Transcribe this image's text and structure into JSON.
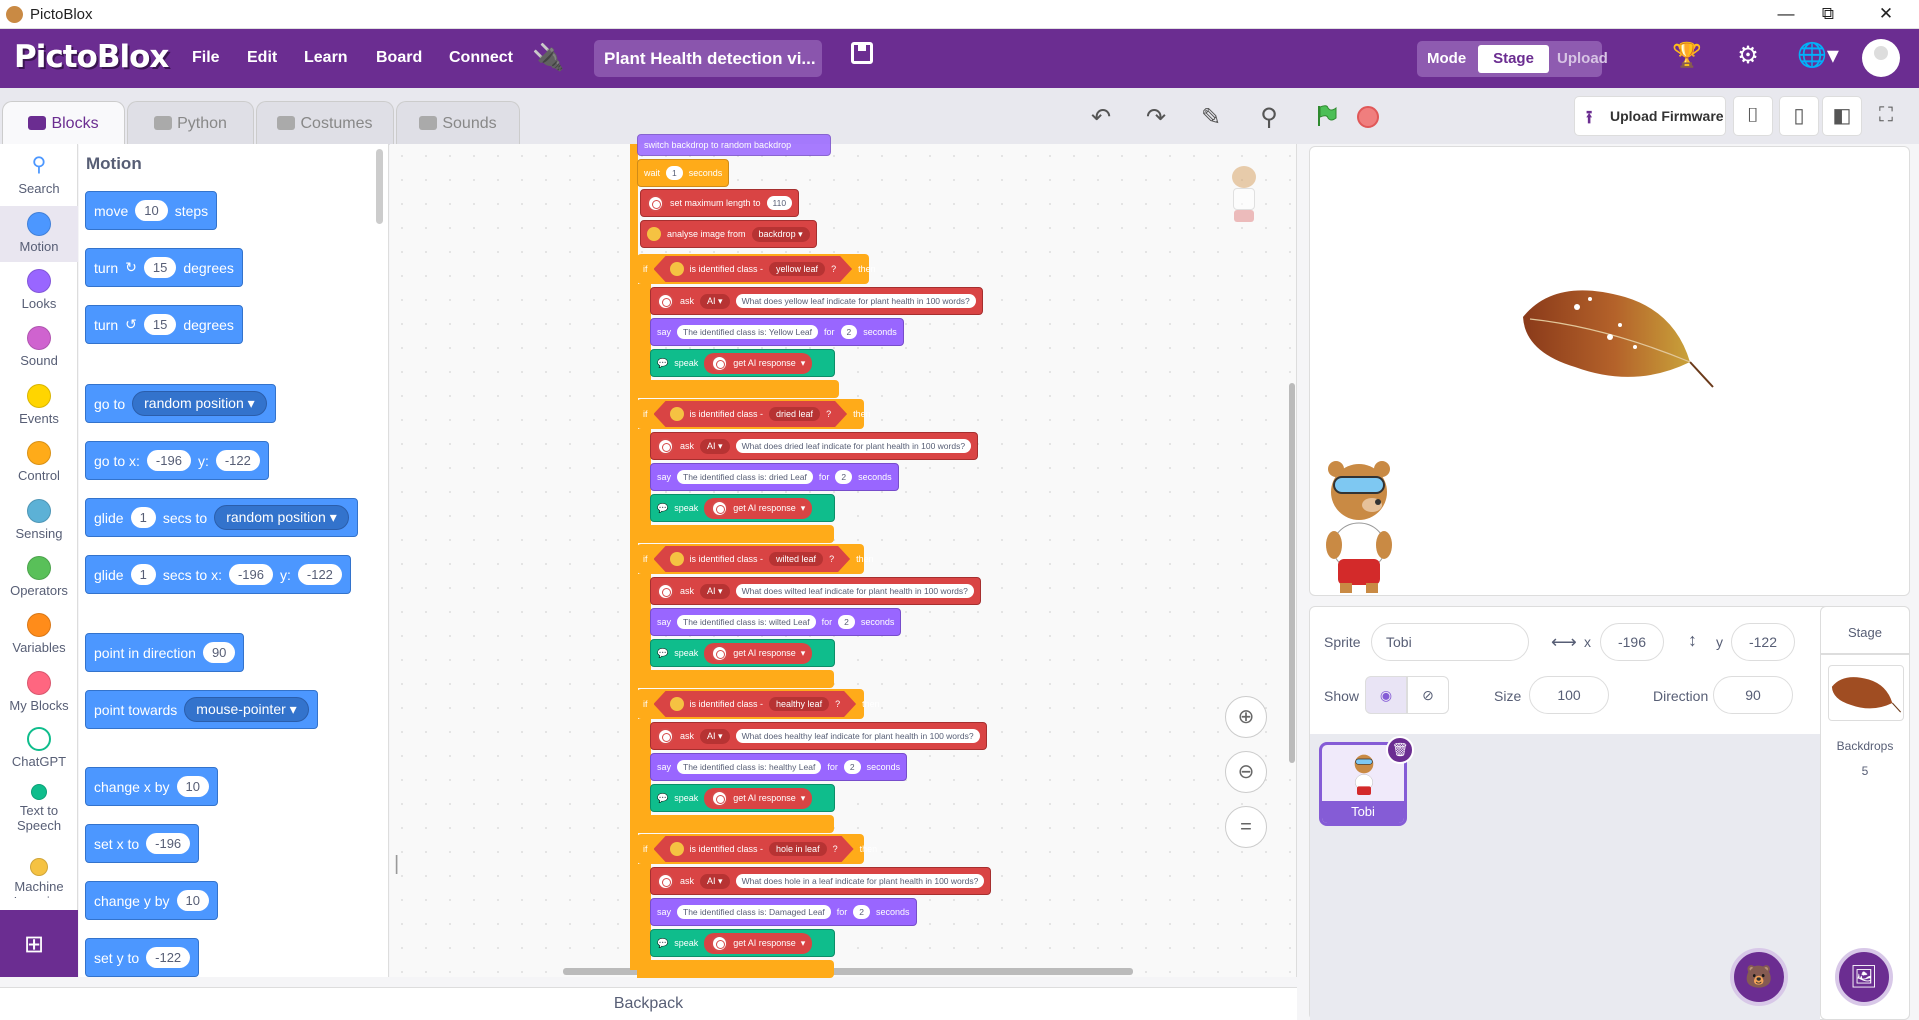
{
  "window": {
    "title": "PictoBlox",
    "minimize": "—",
    "maximize": "⧉",
    "close": "✕"
  },
  "menubar": {
    "logo": "PictoBlox",
    "items": [
      "File",
      "Edit",
      "Learn",
      "Board",
      "Connect"
    ],
    "project_title": "Plant Health detection vi...",
    "mode_label": "Mode",
    "mode_stage": "Stage",
    "mode_upload": "Upload"
  },
  "tabs": {
    "blocks": "Blocks",
    "python": "Python",
    "costumes": "Costumes",
    "sounds": "Sounds"
  },
  "toolbar": {
    "upload_firmware": "Upload Firmware"
  },
  "categories": [
    {
      "label": "Search",
      "color": "#4c97ff"
    },
    {
      "label": "Motion",
      "color": "#4c97ff"
    },
    {
      "label": "Looks",
      "color": "#9966ff"
    },
    {
      "label": "Sound",
      "color": "#cf63cf"
    },
    {
      "label": "Events",
      "color": "#ffd500"
    },
    {
      "label": "Control",
      "color": "#ffab19"
    },
    {
      "label": "Sensing",
      "color": "#5cb1d6"
    },
    {
      "label": "Operators",
      "color": "#59c059"
    },
    {
      "label": "Variables",
      "color": "#ff8c1a"
    },
    {
      "label": "My Blocks",
      "color": "#ff6680"
    },
    {
      "label": "ChatGPT",
      "color": "#0fbd8c"
    },
    {
      "label": "Text to Speech",
      "color": "#0fbd8c"
    },
    {
      "label": "Machine Learning",
      "color": "#f5c242"
    }
  ],
  "palette": {
    "title": "Motion",
    "move": {
      "a": "move",
      "v": "10",
      "b": "steps"
    },
    "turn_right": {
      "a": "turn",
      "v": "15",
      "b": "degrees"
    },
    "turn_left": {
      "a": "turn",
      "v": "15",
      "b": "degrees"
    },
    "goto": {
      "a": "go to",
      "d": "random position"
    },
    "gotoxy": {
      "a": "go to x:",
      "x": "-196",
      "b": "y:",
      "y": "-122"
    },
    "glide": {
      "a": "glide",
      "v": "1",
      "b": "secs to",
      "d": "random position"
    },
    "glidexy": {
      "a": "glide",
      "v": "1",
      "b": "secs to x:",
      "x": "-196",
      "c": "y:",
      "y": "-122"
    },
    "point_dir": {
      "a": "point in direction",
      "v": "90"
    },
    "point_towards": {
      "a": "point towards",
      "d": "mouse-pointer"
    },
    "change_x": {
      "a": "change x by",
      "v": "10"
    },
    "set_x": {
      "a": "set x to",
      "v": "-196"
    },
    "change_y": {
      "a": "change y by",
      "v": "10"
    },
    "set_y": {
      "a": "set y to",
      "v": "-122"
    }
  },
  "script": {
    "top_partial": "switch backdrop to random backdrop",
    "wait": {
      "a": "wait",
      "v": "1",
      "b": "seconds"
    },
    "set_max": {
      "a": "set maximum length to",
      "v": "110"
    },
    "analyse": {
      "a": "analyse image from",
      "d": "backdrop"
    },
    "if_word": "if",
    "then_word": "then",
    "cond_label": "is identified class -",
    "q": "?",
    "ask_word": "ask",
    "ai": "AI",
    "say_word": "say",
    "for_word": "for",
    "seconds": "seconds",
    "speak_word": "speak",
    "get_ai": "get AI response",
    "cases": [
      {
        "class": "yellow leaf",
        "ask": "What does yellow leaf indicate for plant health in 100 words?",
        "say": "The identified class is: Yellow Leaf",
        "secs": "2"
      },
      {
        "class": "dried leaf",
        "ask": "What does dried leaf indicate for plant health in 100 words?",
        "say": "The identified class is: dried Leaf",
        "secs": "2"
      },
      {
        "class": "wilted leaf",
        "ask": "What does wilted leaf indicate for plant health in 100 words?",
        "say": "The identified class is: wilted Leaf",
        "secs": "2"
      },
      {
        "class": "healthy leaf",
        "ask": "What does healthy leaf indicate for plant health in 100 words?",
        "say": "The identified class is: healthy Leaf",
        "secs": "2"
      },
      {
        "class": "hole in leaf",
        "ask": "What does hole in a leaf indicate for plant health in 100 words?",
        "say": "The identified class is: Damaged Leaf",
        "secs": "2"
      }
    ]
  },
  "workspace": {
    "zoom_reset": "="
  },
  "backpack": "Backpack",
  "sprite_info": {
    "sprite_label": "Sprite",
    "sprite_name": "Tobi",
    "x_label": "x",
    "x": "-196",
    "y_label": "y",
    "y": "-122",
    "show_label": "Show",
    "size_label": "Size",
    "size": "100",
    "direction_label": "Direction",
    "direction": "90"
  },
  "sprites": [
    {
      "name": "Tobi"
    }
  ],
  "stage_panel": {
    "title": "Stage",
    "backdrops_label": "Backdrops",
    "backdrops_count": "5"
  }
}
